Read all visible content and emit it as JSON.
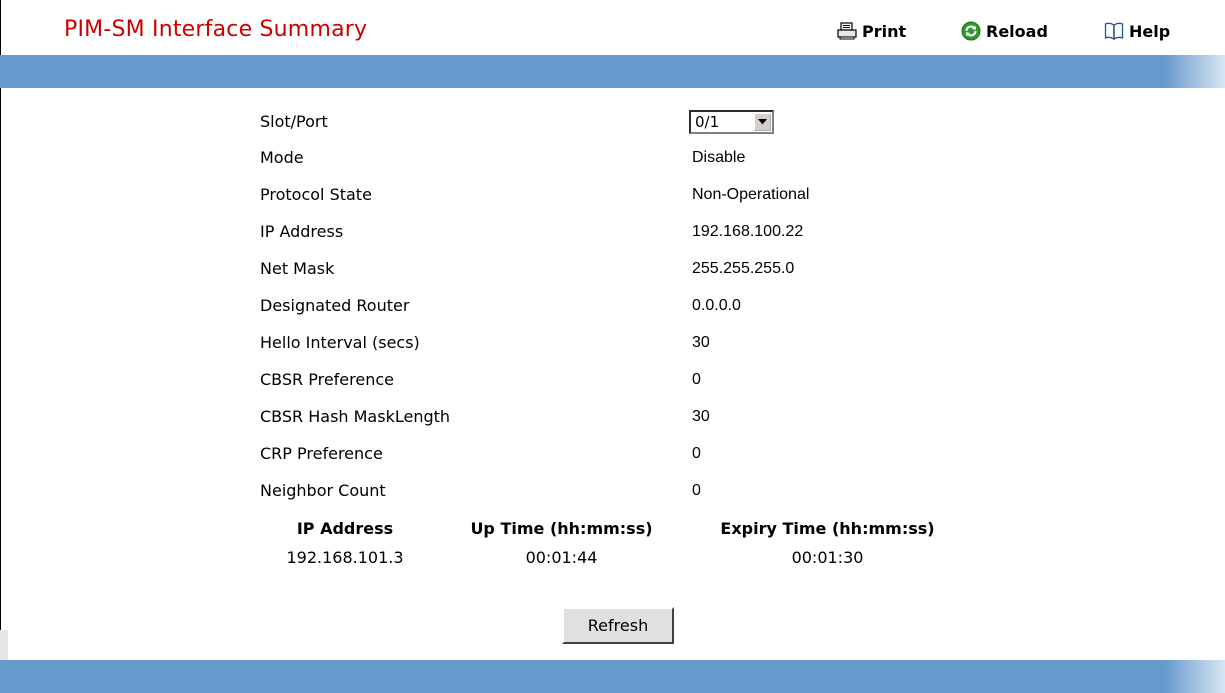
{
  "page": {
    "title": "PIM-SM Interface Summary"
  },
  "toolbar": {
    "print_label": "Print",
    "reload_label": "Reload",
    "help_label": "Help"
  },
  "form": {
    "slot_port": {
      "label": "Slot/Port",
      "value": "0/1"
    },
    "mode": {
      "label": "Mode",
      "value": "Disable"
    },
    "protocol_state": {
      "label": "Protocol State",
      "value": "Non-Operational"
    },
    "ip_address": {
      "label": "IP Address",
      "value": "192.168.100.22"
    },
    "net_mask": {
      "label": "Net Mask",
      "value": "255.255.255.0"
    },
    "designated_router": {
      "label": "Designated Router",
      "value": "0.0.0.0"
    },
    "hello_interval": {
      "label": "Hello Interval (secs)",
      "value": "30"
    },
    "cbsr_preference": {
      "label": "CBSR Preference",
      "value": "0"
    },
    "cbsr_hash_mask_length": {
      "label": "CBSR Hash MaskLength",
      "value": "30"
    },
    "crp_preference": {
      "label": "CRP Preference",
      "value": "0"
    },
    "neighbor_count": {
      "label": "Neighbor Count",
      "value": "0"
    }
  },
  "neighbors": {
    "headers": [
      "IP Address",
      "Up Time (hh:mm:ss)",
      "Expiry Time (hh:mm:ss)"
    ],
    "rows": [
      [
        "192.168.101.3",
        "00:01:44",
        "00:01:30"
      ]
    ]
  },
  "actions": {
    "refresh_label": "Refresh"
  },
  "colors": {
    "title": "#cc0000",
    "band": "#6699cc",
    "reload_icon": "#2e9a2e",
    "help_icon": "#2a4f9e"
  },
  "icons": {
    "print": "printer-icon",
    "reload": "reload-icon",
    "help": "book-icon",
    "dropdown": "chevron-down-icon"
  }
}
